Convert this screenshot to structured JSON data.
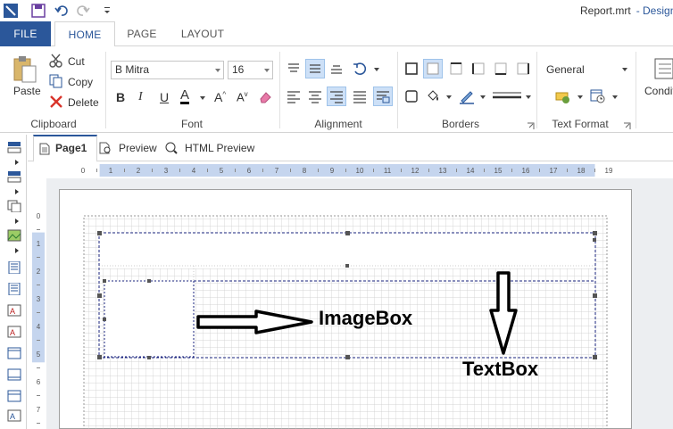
{
  "app": {
    "document_title": "Report.mrt",
    "designer_label": "- Design"
  },
  "tabs": [
    {
      "label": "FILE"
    },
    {
      "label": "HOME"
    },
    {
      "label": "PAGE"
    },
    {
      "label": "LAYOUT"
    }
  ],
  "ribbon": {
    "clipboard": {
      "paste": "Paste",
      "cut": "Cut",
      "copy": "Copy",
      "delete": "Delete",
      "label": "Clipboard"
    },
    "font": {
      "family": "B Mitra",
      "size": "16",
      "bold": "B",
      "italic": "I",
      "underline": "U",
      "font_color": "A",
      "grow": "A",
      "shrink": "A",
      "label": "Font"
    },
    "alignment": {
      "label": "Alignment"
    },
    "borders": {
      "label": "Borders"
    },
    "text_format": {
      "format": "General",
      "label": "Text Format"
    },
    "conditions": {
      "label": "Conditi"
    }
  },
  "page_tabs": [
    {
      "label": "Page1"
    },
    {
      "label": "Preview"
    },
    {
      "label": "HTML Preview"
    }
  ],
  "h_ruler": [
    "0",
    "1",
    "2",
    "3",
    "4",
    "5",
    "6",
    "7",
    "8",
    "9",
    "10",
    "11",
    "12",
    "13",
    "14",
    "15",
    "16",
    "17",
    "18",
    "19"
  ],
  "v_ruler": [
    "0",
    "1",
    "2",
    "3",
    "4",
    "5",
    "6",
    "7"
  ],
  "annotations": {
    "imagebox": "ImageBox",
    "textbox": "TextBox"
  },
  "colors": {
    "accent": "#2b579a",
    "selection": "#1a237e",
    "active_button": "#cde0f7",
    "ruler_highlight": "#c5d5ee"
  }
}
